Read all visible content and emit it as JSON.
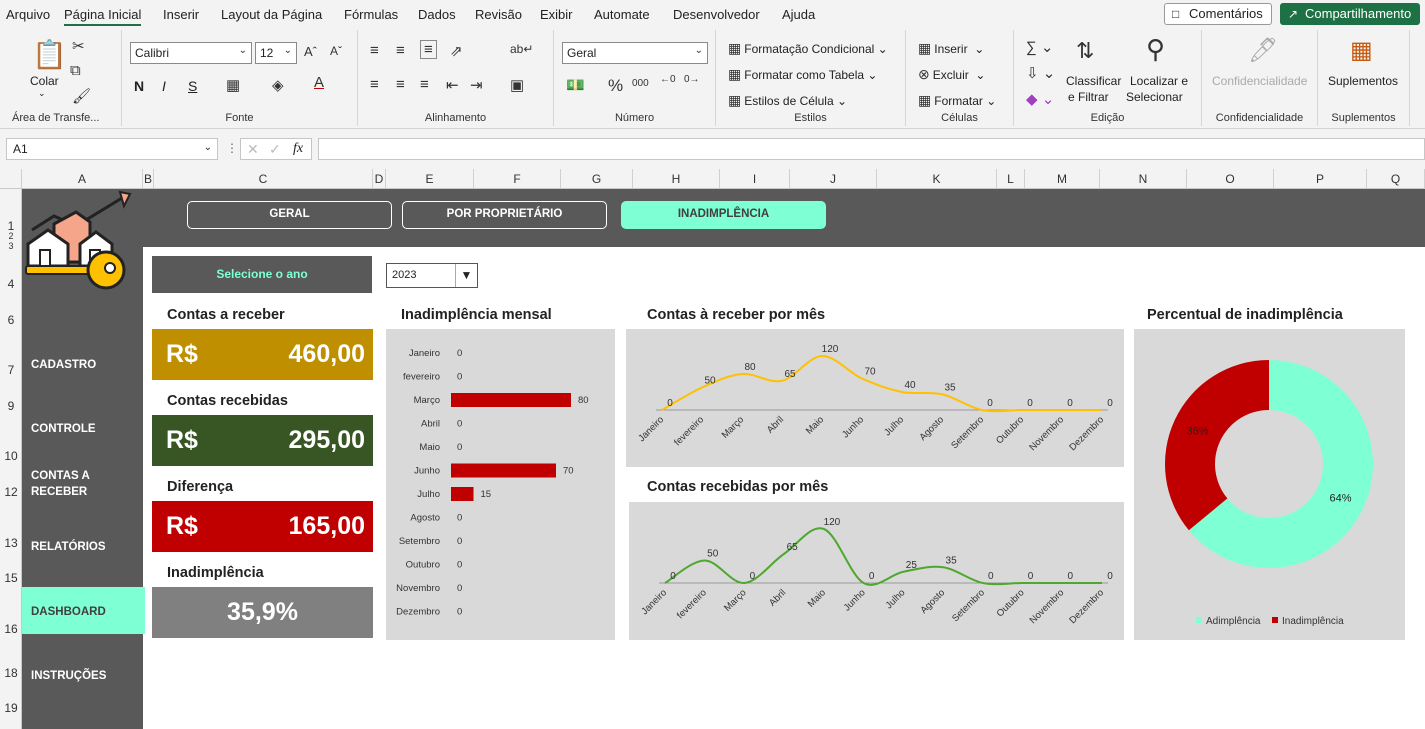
{
  "menu": {
    "items": [
      "Arquivo",
      "Página Inicial",
      "Inserir",
      "Layout da Página",
      "Fórmulas",
      "Dados",
      "Revisão",
      "Exibir",
      "Automate",
      "Desenvolvedor",
      "Ajuda"
    ],
    "comments": "Comentários",
    "share": "Compartilhamento"
  },
  "ribbon": {
    "paste": "Colar",
    "clipboard": "Área de Transfe...",
    "font_name": "Calibri",
    "font_size": "12",
    "font_group": "Fonte",
    "bold": "N",
    "italic": "I",
    "underline": "S",
    "align_group": "Alinhamento",
    "number_format": "Geral",
    "number_group": "Número",
    "cond_format": "Formatação Condicional",
    "format_table": "Formatar como Tabela",
    "cell_styles": "Estilos de Célula",
    "styles_group": "Estilos",
    "insert": "Inserir",
    "delete": "Excluir",
    "format": "Formatar",
    "cells_group": "Células",
    "sort_filter_1": "Classificar",
    "sort_filter_2": "e Filtrar",
    "find_select_1": "Localizar e",
    "find_select_2": "Selecionar",
    "edit_group": "Edição",
    "confidentiality": "Confidencialidade",
    "confidentiality_group": "Confidencialidade",
    "addins": "Suplementos",
    "addins_group": "Suplementos"
  },
  "formula": {
    "namebox": "A1",
    "fx": "fx"
  },
  "columns": [
    "A",
    "B",
    "C",
    "D",
    "E",
    "F",
    "G",
    "H",
    "I",
    "J",
    "K",
    "L",
    "M",
    "N",
    "O",
    "P",
    "Q"
  ],
  "rows": [
    "1",
    "2",
    "3",
    "4",
    "6",
    "7",
    "9",
    "10",
    "12",
    "13",
    "15",
    "16",
    "18",
    "19"
  ],
  "nav": {
    "geral": "GERAL",
    "proprietario": "POR PROPRIETÁRIO",
    "inadimplencia": "INADIMPLÊNCIA"
  },
  "sidebar": [
    "CADASTRO",
    "CONTROLE",
    "CONTAS A",
    "RECEBER",
    "RELATÓRIOS",
    "DASHBOARD",
    "INSTRUÇÕES"
  ],
  "year": {
    "label": "Selecione o ano",
    "value": "2023"
  },
  "kpis": {
    "receivable_title": "Contas a receber",
    "receivable_cur": "R$",
    "receivable_val": "460,00",
    "received_title": "Contas recebidas",
    "received_cur": "R$",
    "received_val": "295,00",
    "diff_title": "Diferença",
    "diff_cur": "R$",
    "diff_val": "165,00",
    "default_title": "Inadimplência",
    "default_val": "35,9%"
  },
  "colors": {
    "gold": "#bf8f00",
    "green": "#375623",
    "red": "#c00000",
    "gray": "#808080",
    "mint": "#7fffd4",
    "dark": "#595959"
  },
  "chart_data": [
    {
      "type": "bar",
      "title": "Inadimplência mensal",
      "categories": [
        "Janeiro",
        "fevereiro",
        "Março",
        "Abril",
        "Maio",
        "Junho",
        "Julho",
        "Agosto",
        "Setembro",
        "Outubro",
        "Novembro",
        "Dezembro"
      ],
      "values": [
        0,
        0,
        80,
        0,
        0,
        70,
        15,
        0,
        0,
        0,
        0,
        0
      ],
      "color": "#c00000",
      "orientation": "horizontal"
    },
    {
      "type": "line",
      "title": "Contas à receber por mês",
      "categories": [
        "Janeiro",
        "fevereiro",
        "Março",
        "Abril",
        "Maio",
        "Junho",
        "Julho",
        "Agosto",
        "Setembro",
        "Outubro",
        "Novembro",
        "Dezembro"
      ],
      "values": [
        0,
        50,
        80,
        65,
        120,
        70,
        40,
        35,
        0,
        0,
        0,
        0
      ],
      "color": "#ffc000"
    },
    {
      "type": "line",
      "title": "Contas recebidas por mês",
      "categories": [
        "Janeiro",
        "fevereiro",
        "Março",
        "Abril",
        "Maio",
        "Junho",
        "Julho",
        "Agosto",
        "Setembro",
        "Outubro",
        "Novembro",
        "Dezembro"
      ],
      "values": [
        0,
        50,
        0,
        65,
        120,
        0,
        25,
        35,
        0,
        0,
        0,
        0
      ],
      "color": "#4ea72e"
    },
    {
      "type": "pie",
      "title": "Percentual de inadimplência",
      "slices": [
        {
          "name": "Adimplência",
          "value": 64,
          "label": "64%",
          "color": "#7fffd4"
        },
        {
          "name": "Inadimplência",
          "value": 36,
          "label": "36%",
          "color": "#c00000"
        }
      ],
      "legend": "bottom"
    }
  ]
}
